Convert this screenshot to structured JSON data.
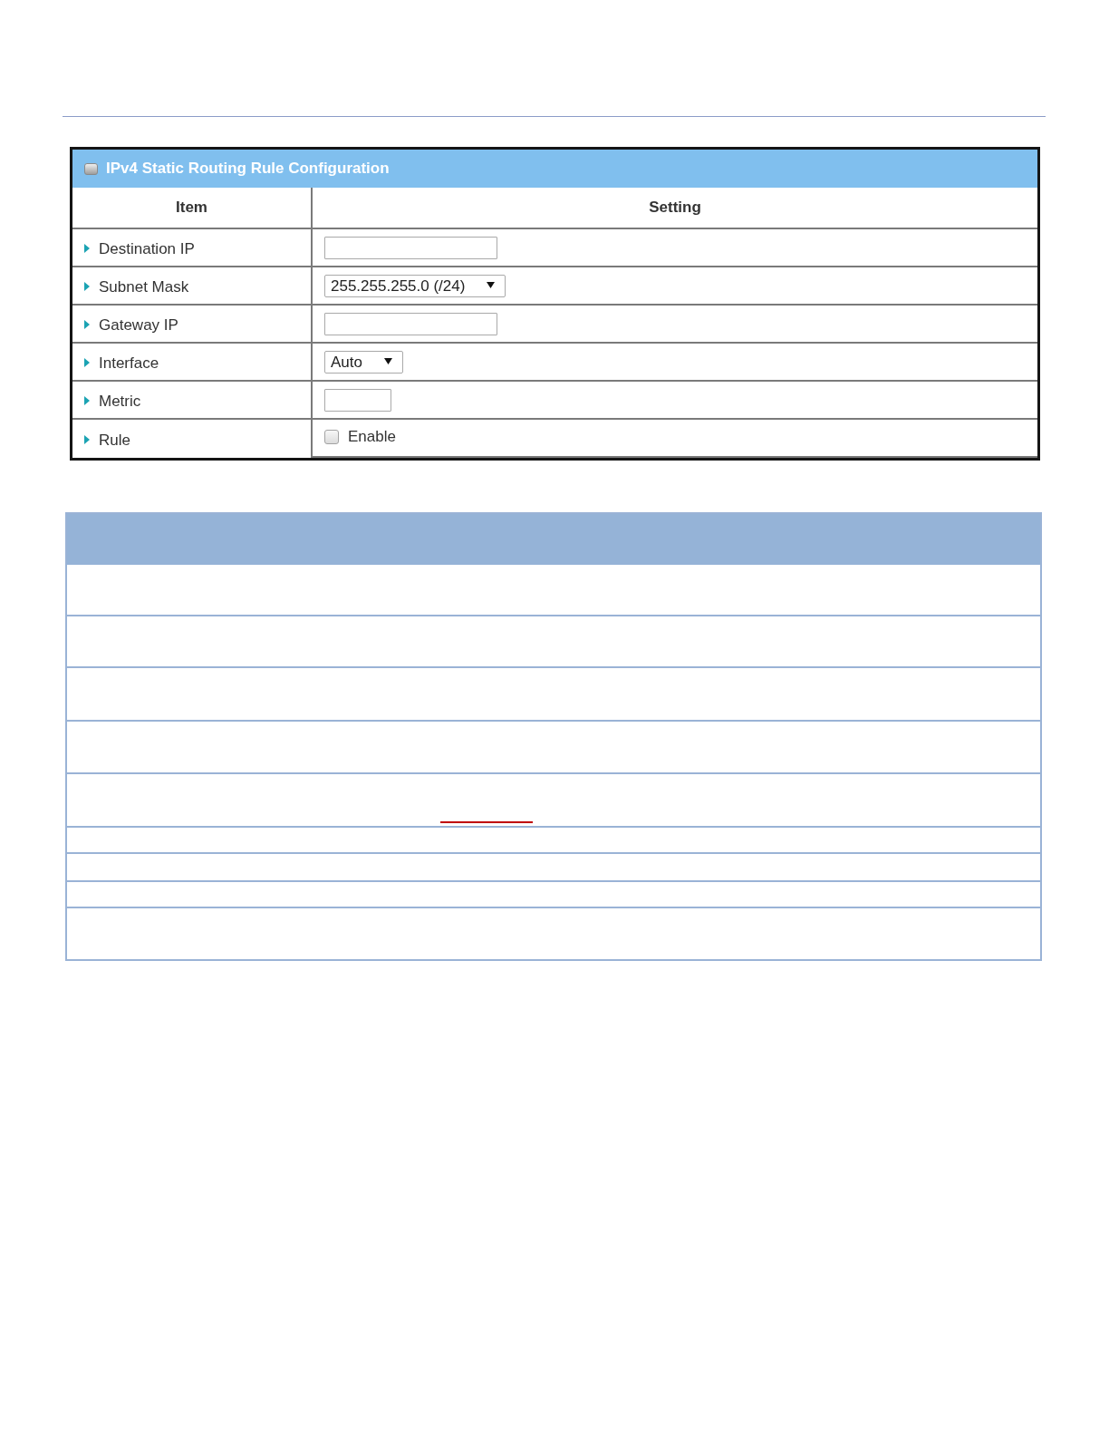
{
  "panel": {
    "title": "IPv4 Static Routing Rule Configuration",
    "columns": [
      "Item",
      "Setting"
    ],
    "rows": [
      {
        "label": "Destination IP",
        "kind": "text"
      },
      {
        "label": "Subnet Mask",
        "kind": "select",
        "value": "255.255.255.0 (/24)"
      },
      {
        "label": "Gateway IP",
        "kind": "text"
      },
      {
        "label": "Interface",
        "kind": "select",
        "value": "Auto"
      },
      {
        "label": "Metric",
        "kind": "number"
      },
      {
        "label": "Rule",
        "kind": "checkbox",
        "option": "Enable",
        "checked": false
      }
    ]
  }
}
